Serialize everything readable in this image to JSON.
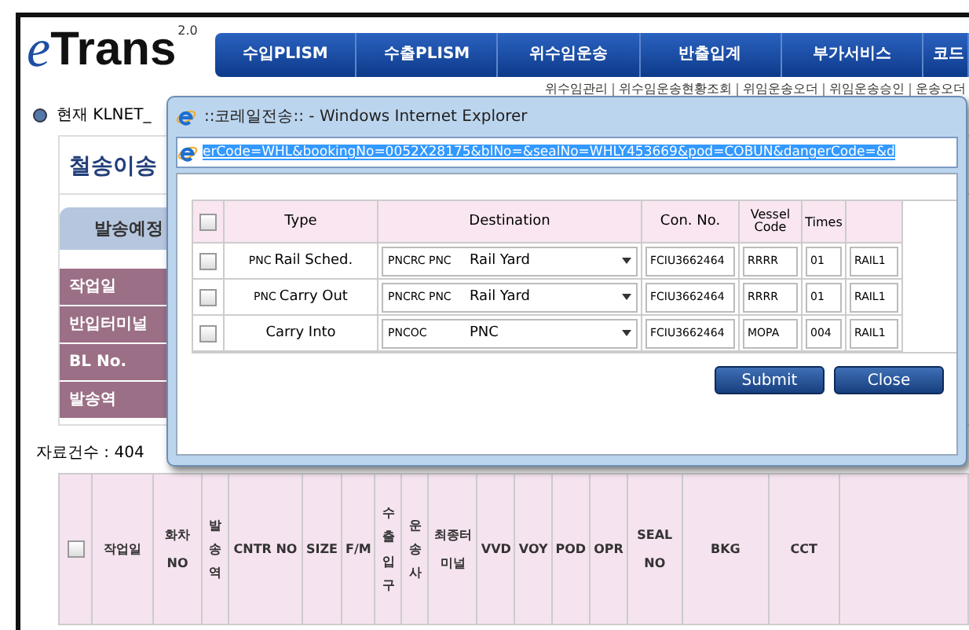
{
  "logo": {
    "text": "Trans",
    "initial": "e",
    "version": "2.0"
  },
  "nav": [
    "수입PLISM",
    "수출PLISM",
    "위수임운송",
    "반출입계",
    "부가서비스",
    "코드"
  ],
  "submenu": [
    "위수임관리",
    "위수임운송현황조회",
    "위임운송오더",
    "위임운송승인",
    "운송오더"
  ],
  "location": "현재 KLNET_",
  "panel": {
    "title": "철송이송",
    "tabs": [
      {
        "label": "발송예정",
        "selected": true
      }
    ],
    "fields": [
      "작업일",
      "반입터미널",
      "BL No.",
      "발송역"
    ]
  },
  "record_count": "자료건수 : 404",
  "table": {
    "columns": [
      {
        "kind": "checkbox",
        "checked": false
      },
      {
        "kind": "text",
        "label": "작업일"
      },
      {
        "kind": "wrap",
        "label": "화차 NO"
      },
      {
        "kind": "vertical",
        "label": "발송역"
      },
      {
        "kind": "text",
        "label": "CNTR NO"
      },
      {
        "kind": "text",
        "label": "SIZE"
      },
      {
        "kind": "text",
        "label": "F/M"
      },
      {
        "kind": "vertical",
        "label": "수출입구"
      },
      {
        "kind": "vertical",
        "label": "운송사"
      },
      {
        "kind": "wrap",
        "label": "최종터미널"
      },
      {
        "kind": "text",
        "label": "VVD"
      },
      {
        "kind": "text",
        "label": "VOY"
      },
      {
        "kind": "text",
        "label": "POD"
      },
      {
        "kind": "text",
        "label": "OPR"
      },
      {
        "kind": "wrap",
        "label": "SEAL NO"
      },
      {
        "kind": "text",
        "label": "BKG"
      },
      {
        "kind": "text",
        "label": "CCT"
      }
    ]
  },
  "popup": {
    "title": "::코레일전송:: - Windows Internet Explorer",
    "address": "erCode=WHL&bookingNo=0052X28175&blNo=&sealNo=WHLY453669&pod=COBUN&dangerCode=&d",
    "header_checked": false,
    "columns": [
      "Type",
      "Destination",
      "Con. No.",
      "Vessel Code",
      "Times"
    ],
    "rows": [
      {
        "checked": false,
        "type_prefix": "PNC",
        "type": "Rail Sched.",
        "dest_code": "PNCRC PNC",
        "dest_name": "Rail Yard",
        "con_no": "FCIU3662464",
        "vessel_code": "RRRR",
        "times": "01",
        "column_7": "RAIL1"
      },
      {
        "checked": false,
        "type_prefix": "PNC",
        "type": "Carry Out",
        "dest_code": "PNCRC PNC",
        "dest_name": "Rail Yard",
        "con_no": "FCIU3662464",
        "vessel_code": "RRRR",
        "times": "01",
        "column_7": "RAIL1"
      },
      {
        "checked": false,
        "type": "Carry Into",
        "dest_code": "PNCOC",
        "dest_name": "PNC",
        "con_no": "FCIU3662464",
        "vessel_code": "MOPA",
        "times": "004",
        "column_7": "RAIL1"
      }
    ],
    "buttons": [
      "Submit",
      "Close"
    ]
  }
}
